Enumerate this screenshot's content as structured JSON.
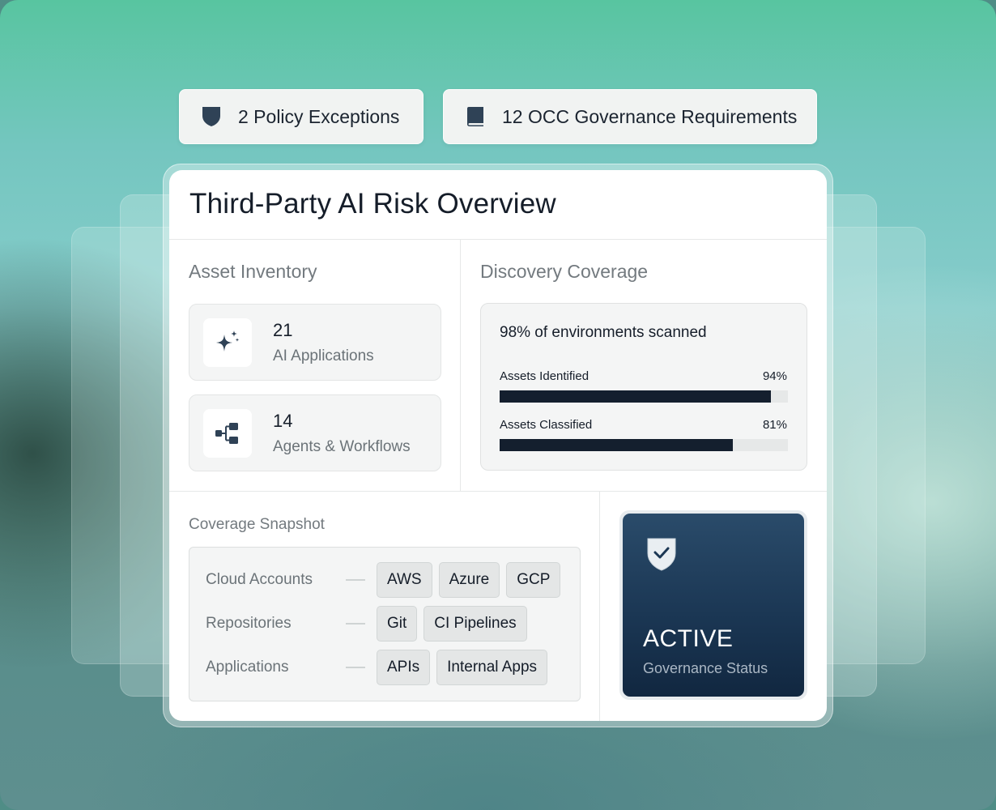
{
  "pills": [
    {
      "icon": "shield-icon",
      "label": "2 Policy Exceptions"
    },
    {
      "icon": "book-icon",
      "label": "12 OCC Governance Requirements"
    }
  ],
  "card": {
    "title": "Third-Party AI Risk Overview"
  },
  "asset_inventory": {
    "title": "Asset Inventory",
    "items": [
      {
        "icon": "sparkle-icon",
        "count": "21",
        "label": "AI Applications"
      },
      {
        "icon": "workflow-icon",
        "count": "14",
        "label": "Agents & Workflows"
      }
    ]
  },
  "discovery": {
    "title": "Discovery Coverage",
    "headline": "98% of environments scanned",
    "bars": [
      {
        "label": "Assets Identified",
        "value_text": "94%",
        "value": 94
      },
      {
        "label": "Assets Classified",
        "value_text": "81%",
        "value": 81
      }
    ],
    "bar_color": "#141f2e"
  },
  "snapshot": {
    "title": "Coverage Snapshot",
    "rows": [
      {
        "label": "Cloud Accounts",
        "chips": [
          "AWS",
          "Azure",
          "GCP"
        ]
      },
      {
        "label": "Repositories",
        "chips": [
          "Git",
          "CI Pipelines"
        ]
      },
      {
        "label": "Applications",
        "chips": [
          "APIs",
          "Internal Apps"
        ]
      }
    ]
  },
  "status": {
    "icon": "shield-check-icon",
    "value": "ACTIVE",
    "label": "Governance Status",
    "color": "#1b3754"
  }
}
